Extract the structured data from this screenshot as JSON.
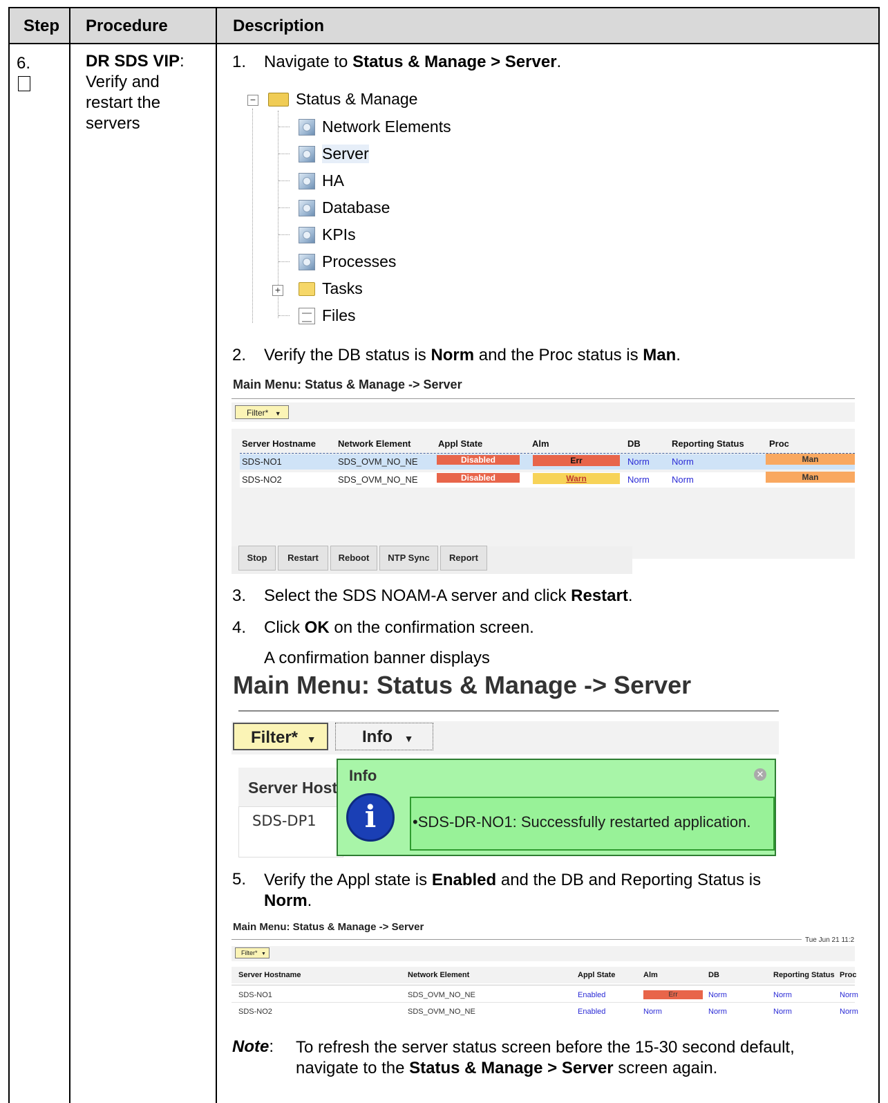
{
  "header": {
    "step": "Step",
    "procedure": "Procedure",
    "description": "Description"
  },
  "step": {
    "number": "6.",
    "procedure_bold": "DR SDS VIP",
    "procedure_rest": "Verify and restart the servers"
  },
  "instructions": {
    "i1": {
      "num": "1.",
      "pre": "Navigate to ",
      "bold": "Status & Manage > Server",
      "post": "."
    },
    "i2": {
      "num": "2.",
      "pre": "Verify the DB status is ",
      "bold1": "Norm",
      "mid": " and the Proc status is ",
      "bold2": "Man",
      "post": "."
    },
    "i3": {
      "num": "3.",
      "pre": "Select the SDS NOAM-A server and click ",
      "bold": "Restart",
      "post": "."
    },
    "i4": {
      "num": "4.",
      "pre": "Click ",
      "bold": "OK",
      "post": " on the confirmation screen."
    },
    "i4_sub": "A confirmation banner displays",
    "i5": {
      "num": "5.",
      "pre": "Verify the Appl state is ",
      "bold1": "Enabled",
      "mid": " and the DB and Reporting Status is",
      "bold2": "Norm",
      "post": "."
    }
  },
  "tree": {
    "root": "Status & Manage",
    "items": [
      "Network Elements",
      "Server",
      "HA",
      "Database",
      "KPIs",
      "Processes"
    ],
    "tasks": "Tasks",
    "files": "Files"
  },
  "shot1": {
    "title": "Main Menu: Status & Manage -> Server",
    "filter": "Filter*",
    "columns": [
      "Server Hostname",
      "Network Element",
      "Appl State",
      "Alm",
      "DB",
      "Reporting Status",
      "Proc"
    ],
    "rows": [
      {
        "host": "SDS-NO1",
        "ne": "SDS_OVM_NO_NE",
        "appl": "Disabled",
        "alm": "Err",
        "db": "Norm",
        "rep": "Norm",
        "proc": "Man"
      },
      {
        "host": "SDS-NO2",
        "ne": "SDS_OVM_NO_NE",
        "appl": "Disabled",
        "alm": "Warn",
        "db": "Norm",
        "rep": "Norm",
        "proc": "Man"
      }
    ],
    "buttons": [
      "Stop",
      "Restart",
      "Reboot",
      "NTP Sync",
      "Report"
    ],
    "colors": {
      "disabled": "#e8654a",
      "err": "#e8654a",
      "warn": "#f7d358",
      "man": "#f9a860",
      "selected": "#cfe3f7"
    }
  },
  "shot2": {
    "title": "Main Menu: Status & Manage -> Server",
    "filter": "Filter*",
    "info_btn": "Info",
    "col_header": "Server Host",
    "cell": "SDS-DP1",
    "popup_title": "Info",
    "message_host": "•SDS-DR-NO1",
    "message_text": ": Successfully restarted application.",
    "colors": {
      "popup_bg": "#a8f5a8",
      "popup_border": "#2e7d32",
      "info_icon": "#1a3fb5"
    }
  },
  "shot3": {
    "title": "Main Menu: Status & Manage -> Server",
    "timestamp": "Tue Jun 21 11:2",
    "filter": "Filter*",
    "columns": [
      "Server Hostname",
      "Network Element",
      "Appl State",
      "Alm",
      "DB",
      "Reporting Status",
      "Proc"
    ],
    "rows": [
      {
        "host": "SDS-NO1",
        "ne": "SDS_OVM_NO_NE",
        "appl": "Enabled",
        "alm": "Err",
        "db": "Norm",
        "rep": "Norm",
        "proc": "Norm"
      },
      {
        "host": "SDS-NO2",
        "ne": "SDS_OVM_NO_NE",
        "appl": "Enabled",
        "alm": "Norm",
        "db": "Norm",
        "rep": "Norm",
        "proc": "Norm"
      }
    ]
  },
  "note": {
    "label": "Note",
    "line1": "To refresh the server status screen before the 15-30 second default,",
    "line2_pre": "navigate to the ",
    "line2_bold": "Status & Manage > Server",
    "line2_post": " screen again."
  }
}
